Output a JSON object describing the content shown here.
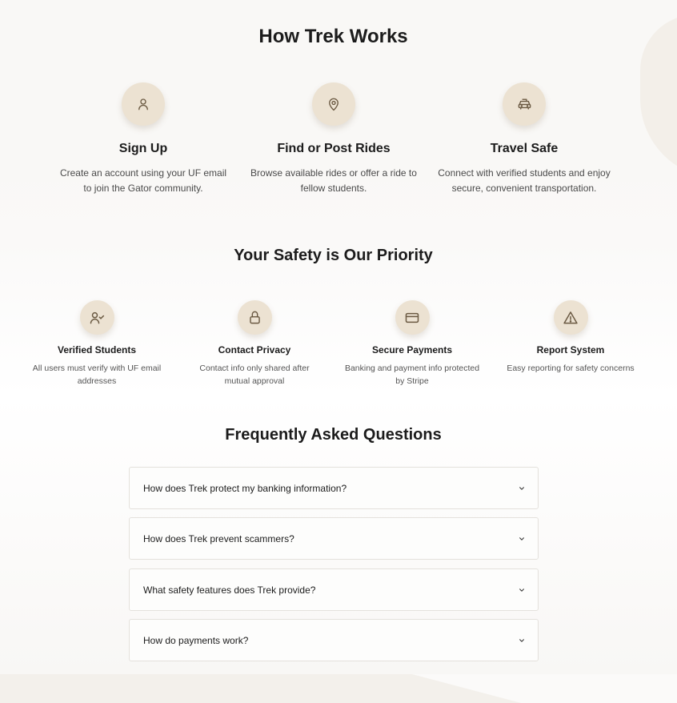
{
  "how_it_works": {
    "title": "How Trek Works",
    "steps": [
      {
        "icon": "user-icon",
        "title": "Sign Up",
        "desc": "Create an account using your UF email to join the Gator community."
      },
      {
        "icon": "map-pin-icon",
        "title": "Find or Post Rides",
        "desc": "Browse available rides or offer a ride to fellow students."
      },
      {
        "icon": "car-icon",
        "title": "Travel Safe",
        "desc": "Connect with verified students and enjoy secure, convenient transportation."
      }
    ]
  },
  "safety": {
    "title": "Your Safety is Our Priority",
    "features": [
      {
        "icon": "user-check-icon",
        "title": "Verified Students",
        "desc": "All users must verify with UF email addresses"
      },
      {
        "icon": "lock-icon",
        "title": "Contact Privacy",
        "desc": "Contact info only shared after mutual approval"
      },
      {
        "icon": "credit-card-icon",
        "title": "Secure Payments",
        "desc": "Banking and payment info protected by Stripe"
      },
      {
        "icon": "alert-triangle-icon",
        "title": "Report System",
        "desc": "Easy reporting for safety concerns"
      }
    ]
  },
  "faq": {
    "title": "Frequently Asked Questions",
    "items": [
      {
        "question": "How does Trek protect my banking information?"
      },
      {
        "question": "How does Trek prevent scammers?"
      },
      {
        "question": "What safety features does Trek provide?"
      },
      {
        "question": "How do payments work?"
      }
    ]
  },
  "colors": {
    "icon_circle": "#ece2d2",
    "icon_stroke": "#6b5a43",
    "accent_blob": "#f3efe9"
  }
}
